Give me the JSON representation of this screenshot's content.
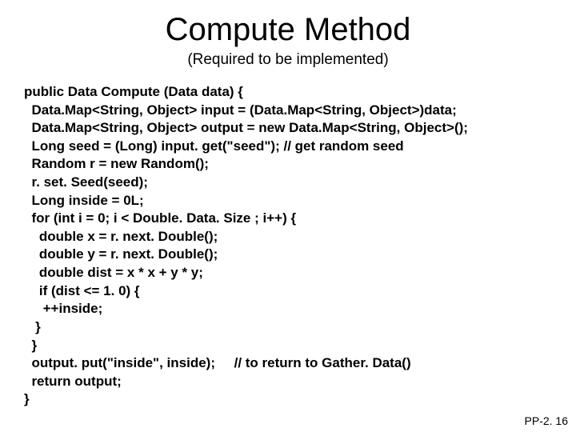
{
  "title": "Compute Method",
  "subtitle": "(Required to be implemented)",
  "code": "public Data Compute (Data data) {\n  Data.Map<String, Object> input = (Data.Map<String, Object>)data;\n  Data.Map<String, Object> output = new Data.Map<String, Object>();\n  Long seed = (Long) input. get(\"seed\"); // get random seed\n  Random r = new Random();\n  r. set. Seed(seed);\n  Long inside = 0L;\n  for (int i = 0; i < Double. Data. Size ; i++) {\n    double x = r. next. Double();\n    double y = r. next. Double();\n    double dist = x * x + y * y;\n    if (dist <= 1. 0) {\n     ++inside;\n   }\n  }\n  output. put(\"inside\", inside);     // to return to Gather. Data()\n  return output;\n}",
  "footer": "PP-2. 16"
}
